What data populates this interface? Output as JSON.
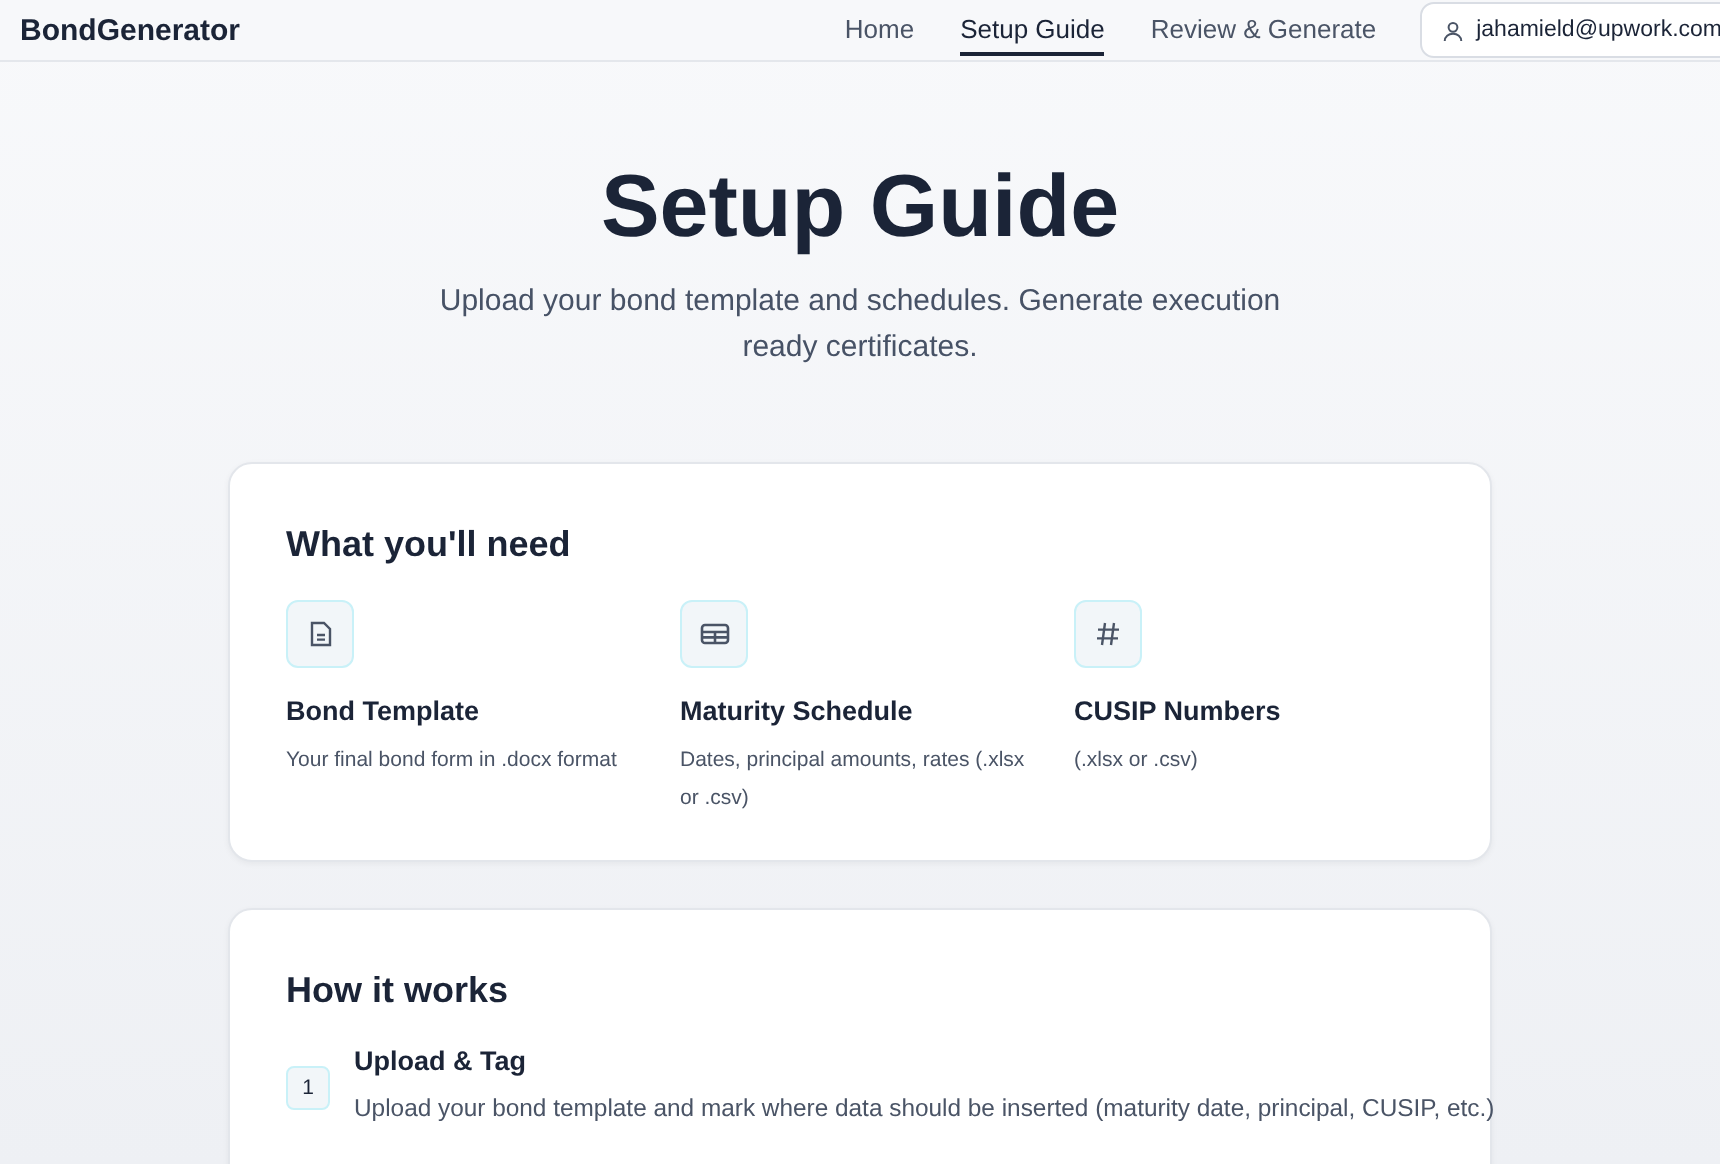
{
  "header": {
    "brand": "BondGenerator",
    "nav": [
      {
        "label": "Home",
        "selected": false
      },
      {
        "label": "Setup Guide",
        "selected": true
      },
      {
        "label": "Review & Generate",
        "selected": false
      }
    ],
    "user": "jahamield@upwork.com"
  },
  "hero": {
    "title": "Setup Guide",
    "subtitle": "Upload your bond template and schedules. Generate execution ready certificates."
  },
  "needs": {
    "heading": "What you'll need",
    "items": [
      {
        "title": "Bond Template",
        "description": "Your final bond form in .docx format"
      },
      {
        "title": "Maturity Schedule",
        "description": "Dates, principal amounts, rates (.xlsx or .csv)"
      },
      {
        "title": "CUSIP Numbers",
        "description": "(.xlsx or .csv)"
      }
    ]
  },
  "how": {
    "heading": "How it works",
    "steps": [
      {
        "number": "1",
        "title": "Upload & Tag",
        "description": "Upload your bond template and mark where data should be inserted (maturity date, principal, CUSIP, etc.)"
      }
    ]
  }
}
